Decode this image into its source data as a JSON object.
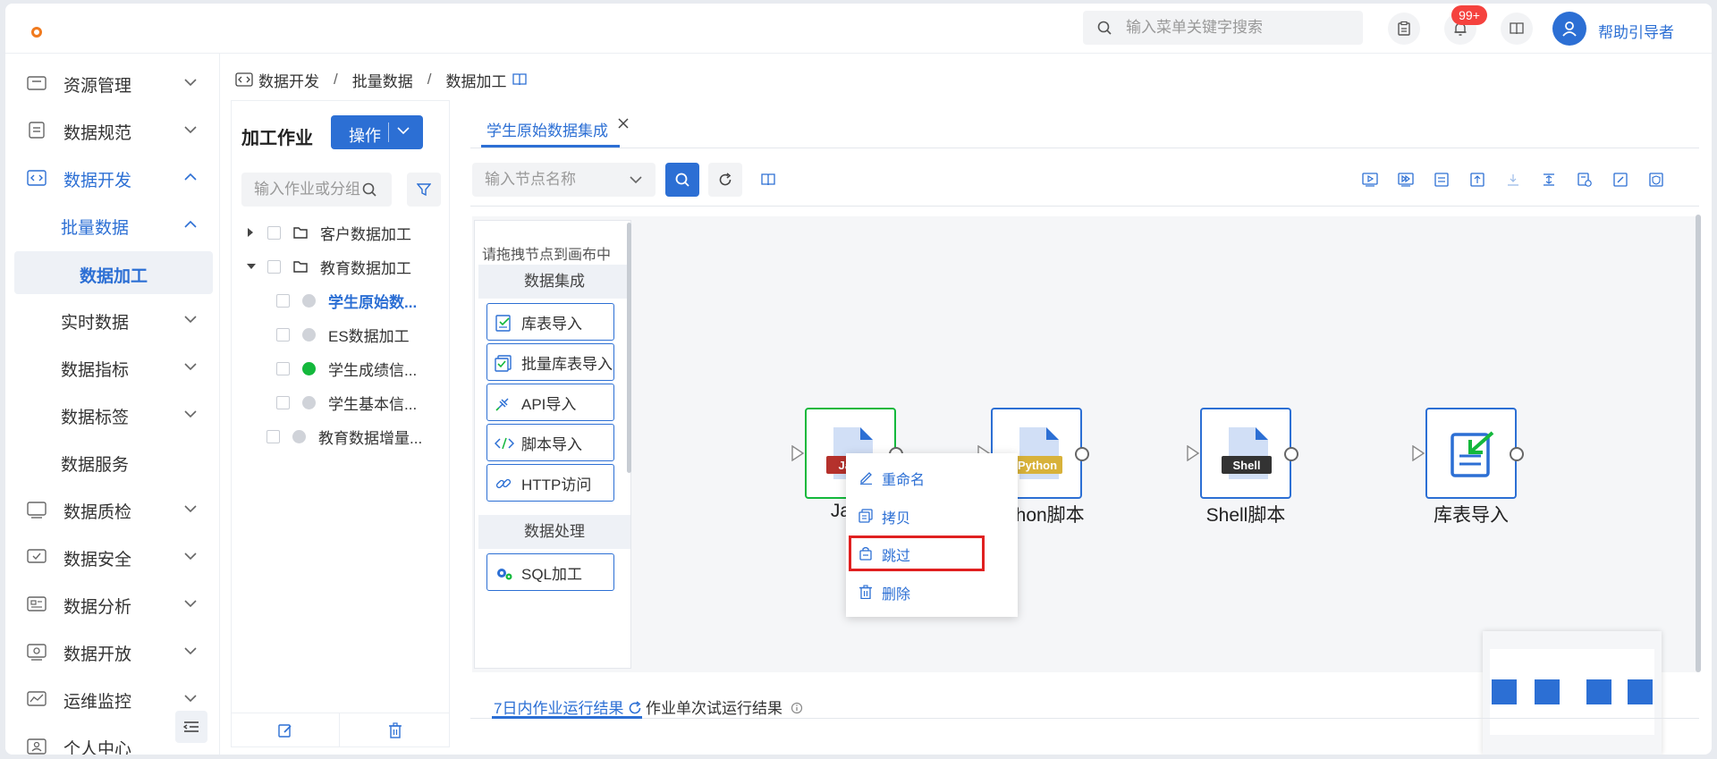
{
  "header": {
    "search_placeholder": "输入菜单关键字搜索",
    "notification_badge": "99+",
    "username": "帮助引导者"
  },
  "sidebar": {
    "items": [
      {
        "label": "资源管理",
        "icon": "resource-icon"
      },
      {
        "label": "数据规范",
        "icon": "spec-icon"
      },
      {
        "label": "数据开发",
        "icon": "code-icon"
      },
      {
        "label": "批量数据"
      },
      {
        "label": "数据加工"
      },
      {
        "label": "实时数据"
      },
      {
        "label": "数据指标"
      },
      {
        "label": "数据标签"
      },
      {
        "label": "数据服务"
      },
      {
        "label": "数据质检",
        "icon": "quality-icon"
      },
      {
        "label": "数据安全",
        "icon": "security-icon"
      },
      {
        "label": "数据分析",
        "icon": "analysis-icon"
      },
      {
        "label": "数据开放",
        "icon": "open-icon"
      },
      {
        "label": "运维监控",
        "icon": "monitor-icon"
      },
      {
        "label": "个人中心",
        "icon": "user-center-icon"
      }
    ]
  },
  "breadcrumb": {
    "items": [
      "数据开发",
      "批量数据",
      "数据加工"
    ],
    "separator": "/"
  },
  "job_panel": {
    "title": "加工作业",
    "op_button": "操作",
    "search_placeholder": "输入作业或分组",
    "tree": [
      {
        "label": "客户数据加工",
        "type": "folder",
        "expanded": false
      },
      {
        "label": "教育数据加工",
        "type": "folder",
        "expanded": true
      },
      {
        "label": "学生原始数...",
        "type": "job",
        "status": "gray",
        "active": true
      },
      {
        "label": "ES数据加工",
        "type": "job",
        "status": "gray"
      },
      {
        "label": "学生成绩信...",
        "type": "job",
        "status": "green"
      },
      {
        "label": "学生基本信...",
        "type": "job",
        "status": "gray"
      },
      {
        "label": "教育数据增量...",
        "type": "job",
        "status": "gray"
      }
    ]
  },
  "workspace": {
    "tab_label": "学生原始数据集成",
    "node_search_placeholder": "输入节点名称",
    "palette": {
      "hint": "请拖拽节点到画布中",
      "section_integration": "数据集成",
      "section_processing": "数据处理",
      "items": [
        "库表导入",
        "批量库表导入",
        "API导入",
        "脚本导入",
        "HTTP访问"
      ],
      "processing_items": [
        "SQL加工"
      ]
    },
    "nodes": [
      {
        "label": "Java",
        "tag": "Java",
        "tag_color": "#b5312c"
      },
      {
        "label": "Python脚本",
        "tag": "Python",
        "tag_color": "#d8b23a"
      },
      {
        "label": "Shell脚本",
        "tag": "Shell",
        "tag_color": "#333333"
      },
      {
        "label": "库表导入",
        "tag": ""
      }
    ],
    "context_menu": [
      "重命名",
      "拷贝",
      "跳过",
      "删除"
    ],
    "result_tabs": [
      "7日内作业运行结果",
      "作业单次试运行结果"
    ]
  },
  "colors": {
    "primary": "#2c6fd4",
    "badge": "#f5423e",
    "success": "#14b83c",
    "highlight": "#e02020"
  }
}
